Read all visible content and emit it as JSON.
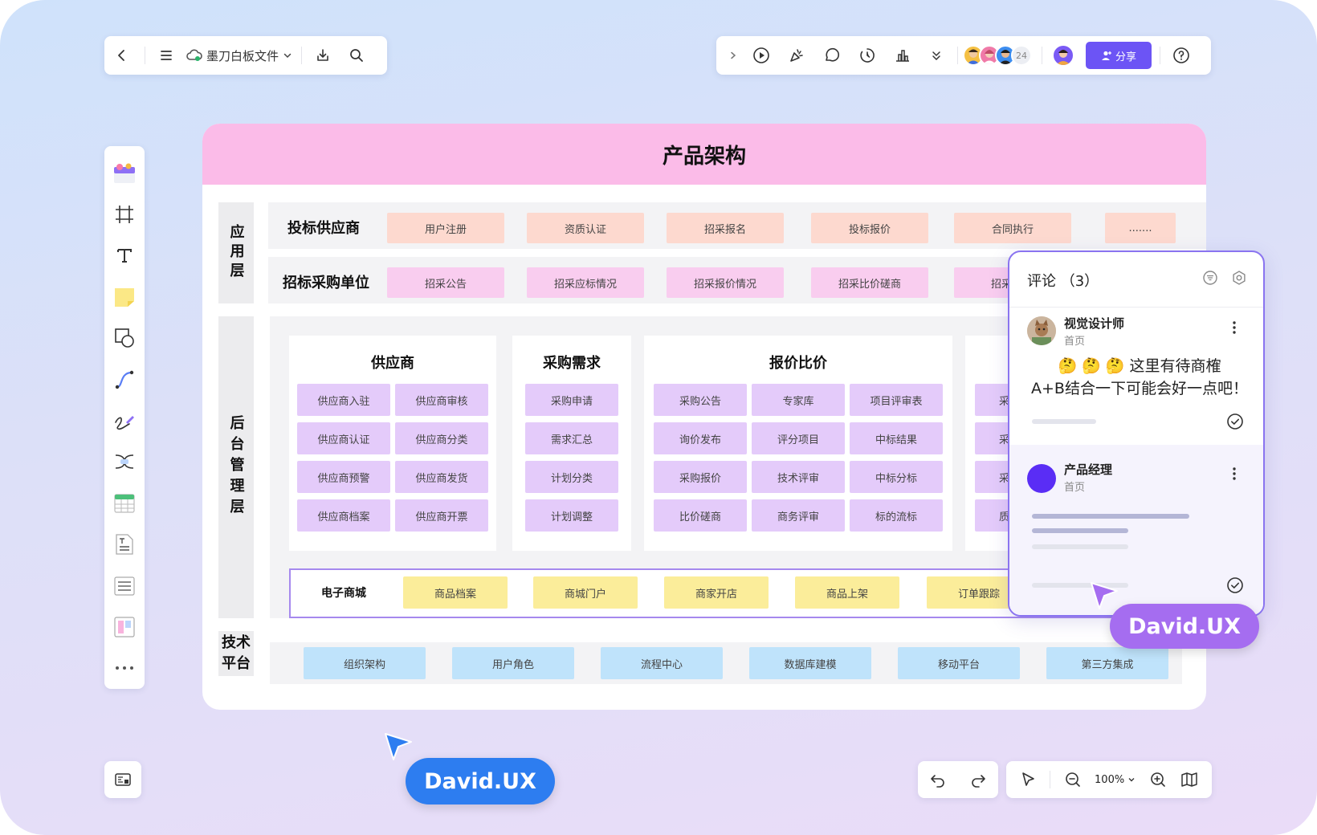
{
  "toolbar_left": {
    "file_name": "墨刀白板文件",
    "icons": [
      "back-icon",
      "menu-icon",
      "cloud-sync-icon",
      "chevron-down-icon",
      "export-icon",
      "search-icon"
    ]
  },
  "toolbar_right": {
    "icons": [
      "chevron-right-icon",
      "play-icon",
      "celebrate-icon",
      "comment-icon",
      "timer-icon",
      "vote-icon",
      "more-down-icon",
      "help-icon"
    ],
    "collaborator_count": "24",
    "share_label": "分享"
  },
  "rail_tools": [
    "template-icon",
    "frame-icon",
    "text-icon",
    "sticky-note-icon",
    "shape-icon",
    "connector-icon",
    "pen-icon",
    "mindmap-icon",
    "table-icon",
    "document-icon",
    "list-icon",
    "kanban-icon",
    "more-icon"
  ],
  "board": {
    "title": "产品架构",
    "layers": {
      "app": "应用层",
      "admin": "后台管理层",
      "tech": "技术平台"
    },
    "app_rows": [
      {
        "title": "投标供应商",
        "items": [
          "用户注册",
          "资质认证",
          "招采报名",
          "投标报价",
          "合同执行",
          "......."
        ]
      },
      {
        "title": "招标采购单位",
        "items": [
          "招采公告",
          "招采应标情况",
          "招采报价情况",
          "招采比价磋商",
          "招采"
        ]
      }
    ],
    "modules": [
      {
        "title": "供应商",
        "items": [
          "供应商入驻",
          "供应商审核",
          "供应商认证",
          "供应商分类",
          "供应商预警",
          "供应商发货",
          "供应商档案",
          "供应商开票"
        ]
      },
      {
        "title": "采购需求",
        "items": [
          "采购申请",
          "需求汇总",
          "计划分类",
          "计划调整"
        ]
      },
      {
        "title": "报价比价",
        "items": [
          "采购公告",
          "专家库",
          "项目评审表",
          "询价发布",
          "评分项目",
          "中标结果",
          "采购报价",
          "技术评审",
          "中标分标",
          "比价磋商",
          "商务评审",
          "标的流标"
        ]
      },
      {
        "title": "",
        "items": [
          "采",
          "采",
          "采",
          "质"
        ]
      }
    ],
    "mall": {
      "title": "电子商城",
      "items": [
        "商品档案",
        "商城门户",
        "商家开店",
        "商品上架",
        "订单跟踪"
      ]
    },
    "tech_items": [
      "组织架构",
      "用户角色",
      "流程中心",
      "数据库建模",
      "移动平台",
      "第三方集成"
    ]
  },
  "comments": {
    "header": "评论 （3）",
    "items": [
      {
        "user": "视觉设计师",
        "page": "首页",
        "emoji": "🤔 🤔 🤔",
        "text_line1": "这里有待商榷",
        "text_line2": "A+B结合一下可能会好一点吧！"
      },
      {
        "user": "产品经理",
        "page": "首页"
      }
    ]
  },
  "cursors": [
    {
      "name": "David.UX",
      "color": "#a56df0"
    },
    {
      "name": "David.UX",
      "color": "#2d7df0"
    }
  ],
  "bottom": {
    "zoom": "100%"
  }
}
